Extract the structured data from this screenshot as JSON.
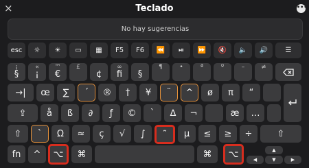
{
  "window": {
    "title": "Teclado",
    "close_icon": "×",
    "more_icon": "•••"
  },
  "suggestions": {
    "text": "No hay sugerencias"
  },
  "row_fn": [
    "esc",
    "☼",
    "☀",
    "▭",
    "▦",
    "F5",
    "F6",
    "⏪",
    "⏯",
    "⏩",
    "🔇",
    "🔈",
    "🔊",
    "☰"
  ],
  "row_num": [
    {
      "top": "¡",
      "bot": "§"
    },
    {
      "top": "«",
      "bot": "¡"
    },
    {
      "top": "™",
      "bot": "€"
    },
    {
      "top": "£",
      "bot": ""
    },
    {
      "top": "",
      "bot": "¢"
    },
    {
      "top": "∞",
      "bot": "fi"
    },
    {
      "top": "",
      "bot": "§"
    },
    {
      "top": "¶",
      "bot": ""
    },
    {
      "top": "•",
      "bot": ""
    },
    {
      "top": "ª",
      "bot": ""
    },
    {
      "top": "º",
      "bot": ""
    },
    {
      "top": "–",
      "bot": ""
    },
    {
      "top": "≠",
      "bot": ""
    }
  ],
  "row_q": [
    "→|",
    "œ",
    "∑",
    "´",
    "®",
    "†",
    "¥",
    "¨",
    "^",
    "ø",
    "π",
    "“",
    ""
  ],
  "row_a": [
    "⇪",
    "å",
    "ß",
    "∂",
    "ƒ",
    "©",
    "`",
    "∆",
    "¬",
    "",
    "æ",
    "…"
  ],
  "row_z": [
    "⇧",
    "`",
    "Ω",
    "≈",
    "ç",
    "√",
    "∫",
    "˜",
    "µ",
    "≤",
    "≥",
    "÷",
    "⇧"
  ],
  "row_bottom": {
    "fn": "fn",
    "ctrl": "^",
    "opt": "⌥",
    "cmd": "⌘",
    "space": "",
    "cmd_r": "⌘",
    "opt_r": "⌥"
  },
  "arrows": {
    "up": "▲",
    "left": "◀",
    "down": "▼",
    "right": "▶"
  }
}
